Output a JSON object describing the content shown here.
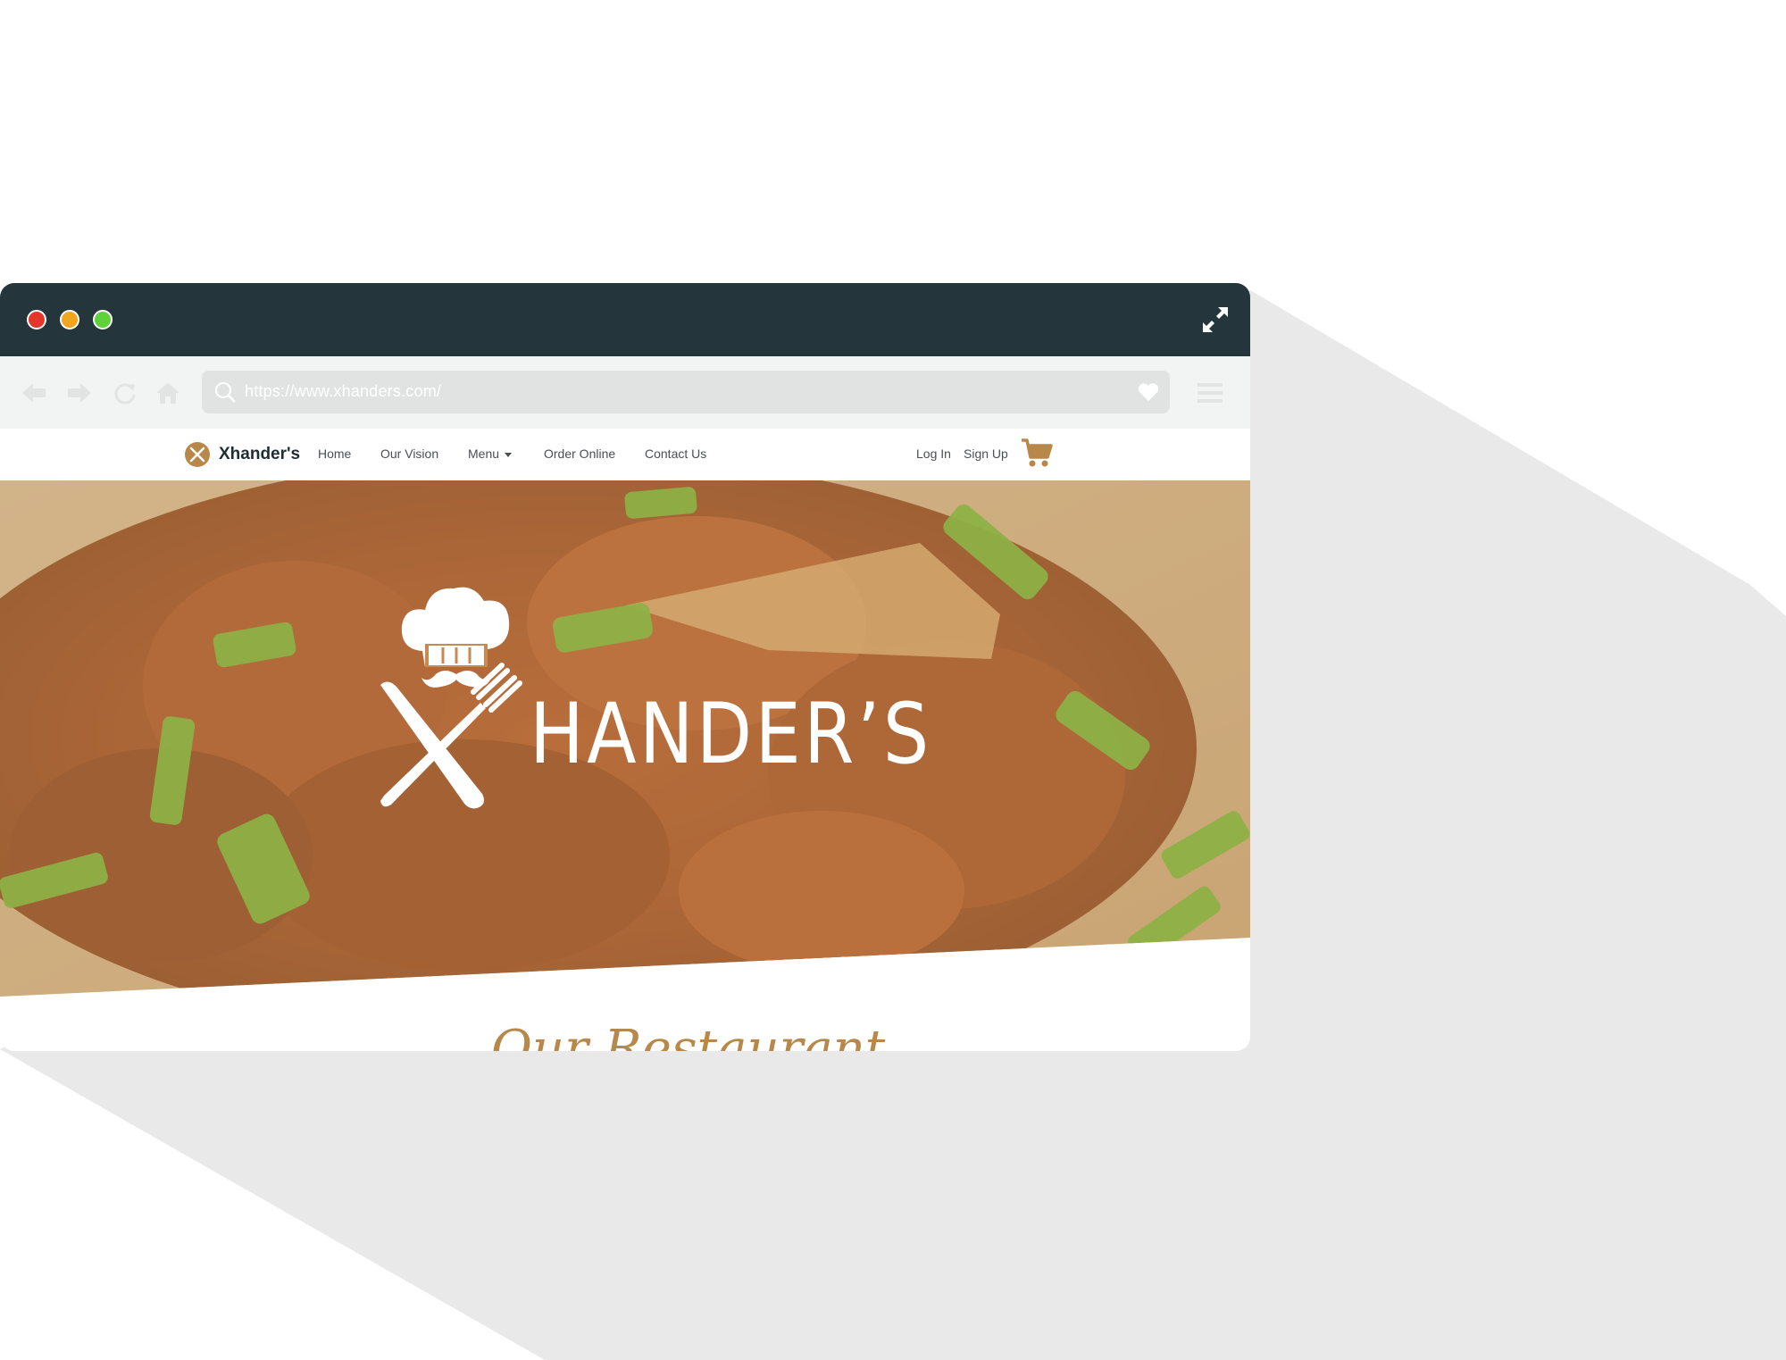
{
  "colors": {
    "titlebar": "#24353b",
    "accent": "#b7884a",
    "toolbar": "#f2f3f3",
    "urlbar": "#e1e3e3"
  },
  "window_controls": {
    "close_icon": "red-circle",
    "minimize_icon": "yellow-circle",
    "maximize_icon": "green-circle",
    "expand_icon": "fullscreen-arrows"
  },
  "browser": {
    "url": "https://www.xhanders.com/"
  },
  "site": {
    "brand": "Xhander's",
    "nav": {
      "home": "Home",
      "vision": "Our Vision",
      "menu": "Menu",
      "order": "Order Online",
      "contact": "Contact Us",
      "login": "Log In",
      "signup": "Sign Up"
    },
    "hero_title": "HANDER’S",
    "section_heading": "Our Restaurant"
  }
}
